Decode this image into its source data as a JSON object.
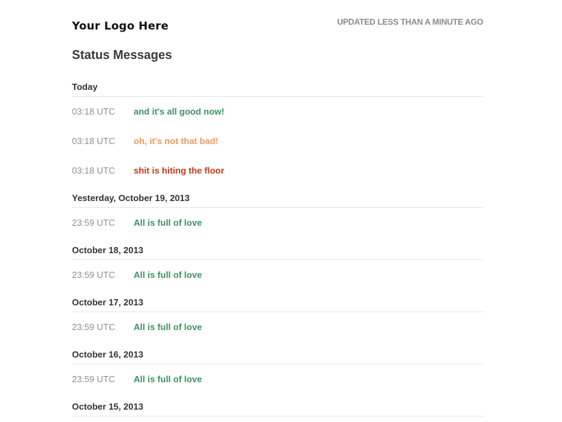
{
  "header": {
    "logo": "Your Logo Here",
    "updated": "UPDATED LESS THAN A MINUTE AGO"
  },
  "title": "Status Messages",
  "colors": {
    "good": "#3a9460",
    "minor": "#ee9a5d",
    "major": "#c4391b"
  },
  "days": [
    {
      "date": "Today",
      "messages": [
        {
          "time": "03:18 UTC",
          "text": "and it's all good now!",
          "status": "good"
        },
        {
          "time": "03:18 UTC",
          "text": "oh, it's not that bad!",
          "status": "minor"
        },
        {
          "time": "03:18 UTC",
          "text": "shit is hiting the floor",
          "status": "major"
        }
      ]
    },
    {
      "date": "Yesterday, October 19, 2013",
      "messages": [
        {
          "time": "23:59 UTC",
          "text": "All is full of love",
          "status": "good"
        }
      ]
    },
    {
      "date": "October 18, 2013",
      "messages": [
        {
          "time": "23:59 UTC",
          "text": "All is full of love",
          "status": "good"
        }
      ]
    },
    {
      "date": "October 17, 2013",
      "messages": [
        {
          "time": "23:59 UTC",
          "text": "All is full of love",
          "status": "good"
        }
      ]
    },
    {
      "date": "October 16, 2013",
      "messages": [
        {
          "time": "23:59 UTC",
          "text": "All is full of love",
          "status": "good"
        }
      ]
    },
    {
      "date": "October 15, 2013",
      "messages": []
    }
  ]
}
